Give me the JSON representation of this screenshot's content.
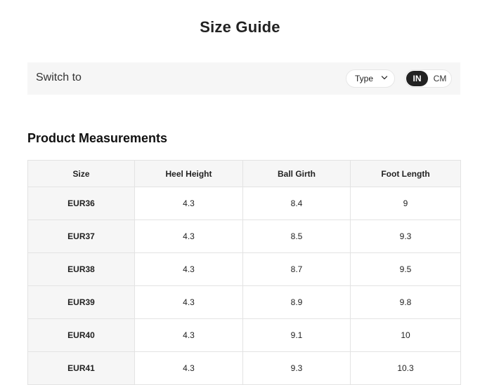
{
  "page": {
    "title": "Size Guide"
  },
  "switch_bar": {
    "label": "Switch to",
    "type_select": {
      "label": "Type",
      "icon": "chevron-down-icon"
    },
    "unit_toggle": {
      "options": [
        "IN",
        "CM"
      ],
      "selected": "IN"
    }
  },
  "measurements": {
    "title": "Product Measurements",
    "columns": [
      "Size",
      "Heel Height",
      "Ball Girth",
      "Foot Length"
    ],
    "rows": [
      [
        "EUR36",
        "4.3",
        "8.4",
        "9"
      ],
      [
        "EUR37",
        "4.3",
        "8.5",
        "9.3"
      ],
      [
        "EUR38",
        "4.3",
        "8.7",
        "9.5"
      ],
      [
        "EUR39",
        "4.3",
        "8.9",
        "9.8"
      ],
      [
        "EUR40",
        "4.3",
        "9.1",
        "10"
      ],
      [
        "EUR41",
        "4.3",
        "9.3",
        "10.3"
      ]
    ]
  },
  "colors": {
    "bar_background": "#f6f6f6",
    "toggle_active": "#222222",
    "border": "#e3e3e3"
  }
}
